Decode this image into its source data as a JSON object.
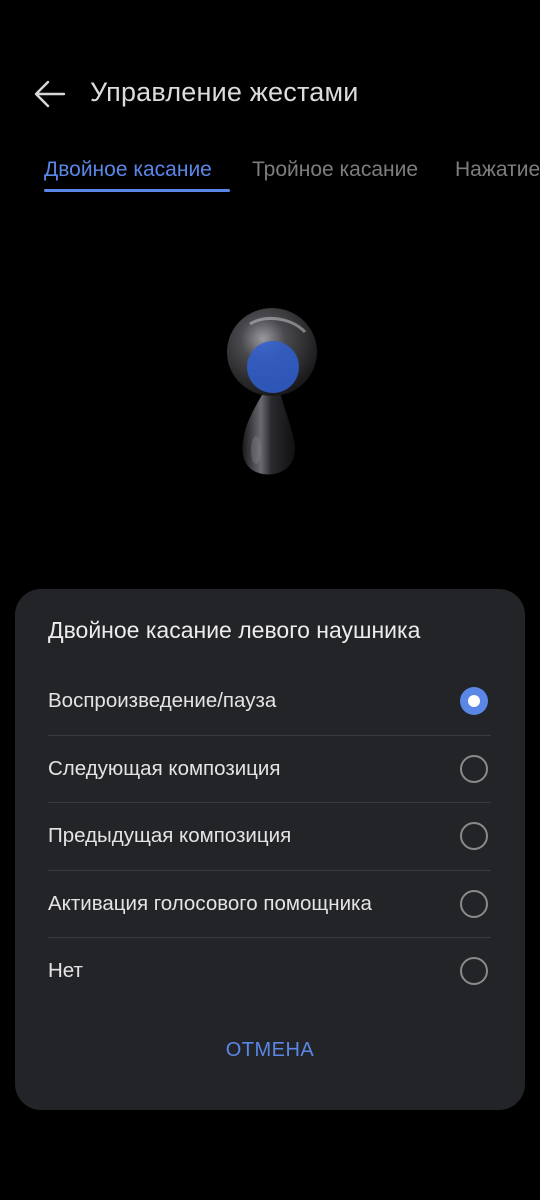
{
  "header": {
    "title": "Управление жестами",
    "back_icon": "arrow-left-icon"
  },
  "tabs": [
    {
      "label": "Двойное касание",
      "active": true
    },
    {
      "label": "Тройное касание",
      "active": false
    },
    {
      "label": "Нажатие и удержание",
      "active": false
    }
  ],
  "illustration": {
    "name": "earbud-icon",
    "highlight_color": "#2f5fd0"
  },
  "sheet": {
    "title": "Двойное касание левого наушника",
    "options": [
      {
        "label": "Воспроизведение/пауза",
        "selected": true
      },
      {
        "label": "Следующая композиция",
        "selected": false
      },
      {
        "label": "Предыдущая композиция",
        "selected": false
      },
      {
        "label": "Активация голосового помощника",
        "selected": false
      },
      {
        "label": "Нет",
        "selected": false
      }
    ],
    "cancel_label": "ОТМЕНА"
  },
  "colors": {
    "accent": "#5a87e6",
    "background": "#000000",
    "sheet_background": "#232427"
  }
}
